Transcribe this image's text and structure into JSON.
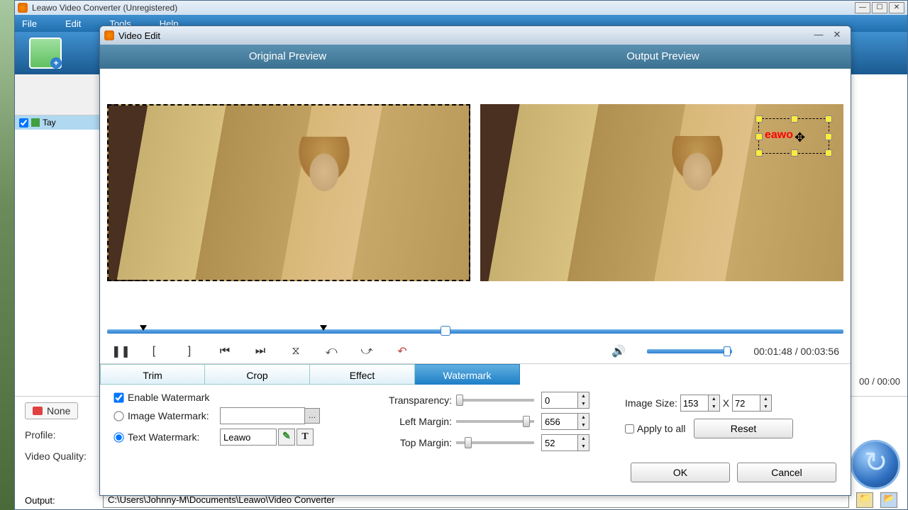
{
  "app": {
    "title": "Leawo Video Converter (Unregistered)",
    "menus": [
      "File",
      "Edit",
      "Tools",
      "Help"
    ]
  },
  "list": {
    "item0": "Tay"
  },
  "bottom": {
    "none": "None",
    "profile": "Profile:",
    "vquality": "Video Quality:",
    "output": "Output:",
    "output_path": "C:\\Users\\Johnny-M\\Documents\\Leawo\\Video Converter"
  },
  "modal": {
    "title": "Video Edit",
    "orig": "Original Preview",
    "out": "Output Preview",
    "wm_text": "eawo",
    "time": "00:01:48 / 00:03:56",
    "tabs": {
      "trim": "Trim",
      "crop": "Crop",
      "effect": "Effect",
      "watermark": "Watermark"
    },
    "panel": {
      "enable": "Enable Watermark",
      "img_wm": "Image Watermark:",
      "txt_wm": "Text Watermark:",
      "txt_val": "Leawo",
      "trans": "Transparency:",
      "left": "Left Margin:",
      "top": "Top  Margin:",
      "trans_val": "0",
      "left_val": "656",
      "top_val": "52",
      "img_size": "Image Size:",
      "w": "153",
      "x": "X",
      "h": "72",
      "apply": "Apply to all",
      "reset": "Reset",
      "ok": "OK",
      "cancel": "Cancel"
    }
  },
  "bg_time": "00 / 00:00"
}
